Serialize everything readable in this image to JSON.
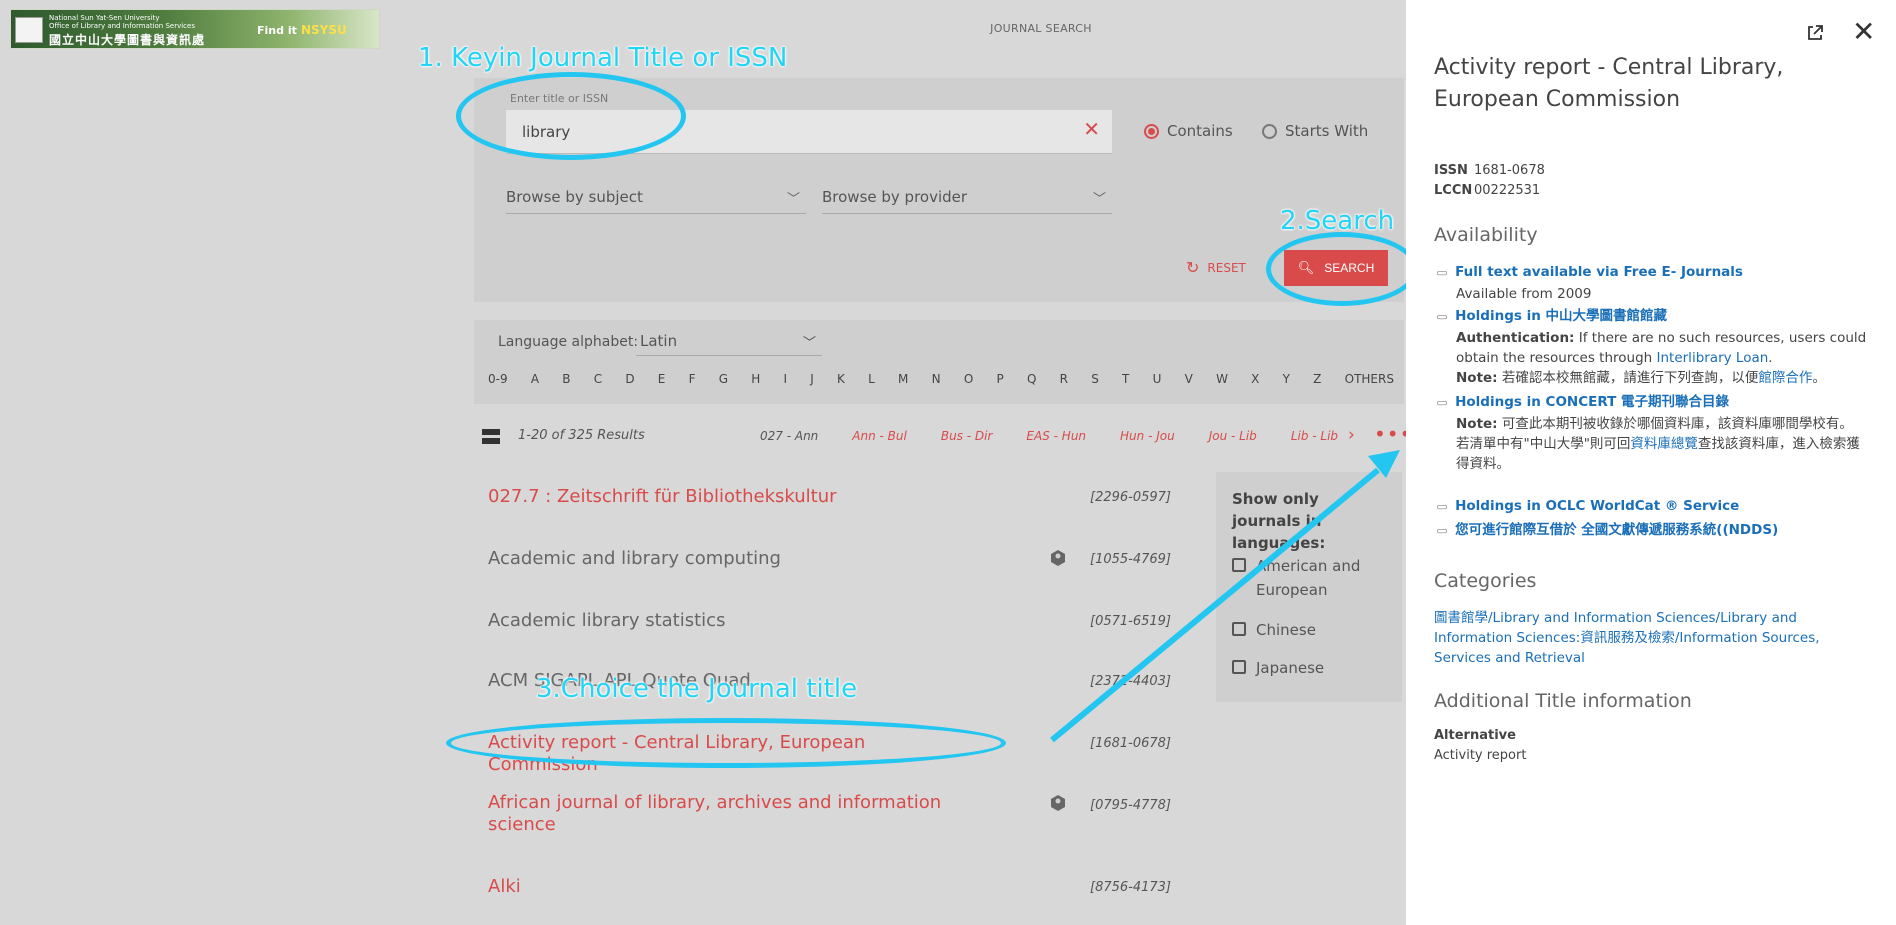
{
  "logo": {
    "line1": "National Sun Yat-Sen University",
    "line2": "Office of Library and Information Services",
    "chinese": "國立中山大學圖書與資訊處",
    "find_it": "Find it",
    "nsysu": "NSYSU"
  },
  "header": {
    "title": "JOURNAL SEARCH"
  },
  "search": {
    "field_label": "Enter title or ISSN",
    "value": "library",
    "match_contains": "Contains",
    "match_starts": "Starts With",
    "browse_subject": "Browse by subject",
    "browse_provider": "Browse by provider",
    "reset_label": "RESET",
    "search_label": "SEARCH"
  },
  "alphabet": {
    "language_label": "Language alphabet:",
    "language_value": "Latin",
    "letters": [
      "0-9",
      "A",
      "B",
      "C",
      "D",
      "E",
      "F",
      "G",
      "H",
      "I",
      "J",
      "K",
      "L",
      "M",
      "N",
      "O",
      "P",
      "Q",
      "R",
      "S",
      "T",
      "U",
      "V",
      "W",
      "X",
      "Y",
      "Z",
      "OTHERS"
    ]
  },
  "results": {
    "count": "1-20 of 325 Results",
    "ranges": [
      "027 - Ann",
      "Ann - Bul",
      "Bus - Dir",
      "EAS - Hun",
      "Hun - Jou",
      "Jou - Lib",
      "Lib - Lib"
    ],
    "items": [
      {
        "title": "027.7 : Zeitschrift für Bibliothekskultur",
        "issn": "[2296-0597]"
      },
      {
        "title": "Academic and library computing",
        "issn": "[1055-4769]"
      },
      {
        "title": "Academic library statistics",
        "issn": "[0571-6519]"
      },
      {
        "title": "ACM SIGAPL APL Quote Quad",
        "issn": "[2372-4403]"
      },
      {
        "title": "Activity report - Central Library, European Commission",
        "issn": "[1681-0678]"
      },
      {
        "title": "African journal of library, archives and information science",
        "issn": "[0795-4778]"
      },
      {
        "title": "Alki",
        "issn": "[8756-4173]"
      }
    ]
  },
  "filter": {
    "title": "Show only journals in languages:",
    "options": [
      "American and European",
      "Chinese",
      "Japanese"
    ]
  },
  "annotations": {
    "step1": "1. Keyin Journal Title or ISSN",
    "step2": "2.Search",
    "step3": "3.Choice the Journal title"
  },
  "detail": {
    "title": "Activity report - Central Library, European Commission",
    "issn_label": "ISSN",
    "issn": "1681-0678",
    "lccn_label": "LCCN",
    "lccn": "00222531",
    "availability_heading": "Availability",
    "links": [
      {
        "label": "Full text available via Free E- Journals",
        "sub": "Available from 2009"
      },
      {
        "label": "Holdings in 中山大學圖書館館藏"
      },
      {
        "label": "Holdings in CONCERT 電子期刊聯合目錄"
      },
      {
        "label": "Holdings in OCLC WorldCat ® Service"
      },
      {
        "label": "您可進行館際互借於 全國文獻傳遞服務系統((NDDS)"
      }
    ],
    "auth_label": "Authentication:",
    "auth_text": "If there are no such resources, users could obtain the resources through",
    "auth_link": "Interlibrary Loan",
    "note_label": "Note:",
    "note1_text": "若確認本校無館藏，請進行下列查詢，以便",
    "note1_link": "館際合作",
    "note2_text": "可查此本期刊被收錄於哪個資料庫，該資料庫哪間學校有。",
    "note3_pre": "若清單中有\"中山大學\"則可回",
    "note3_link": "資料庫總覽",
    "note3_post": "查找該資料庫，進入檢索獲得資料。",
    "categories_heading": "Categories",
    "categories": "圖書館學/Library and Information Sciences/Library and Information Sciences:資訊服務及檢索/Information Sources, Services and Retrieval",
    "additional_heading": "Additional Title information",
    "alt_label": "Alternative",
    "alt_value": "Activity report"
  }
}
